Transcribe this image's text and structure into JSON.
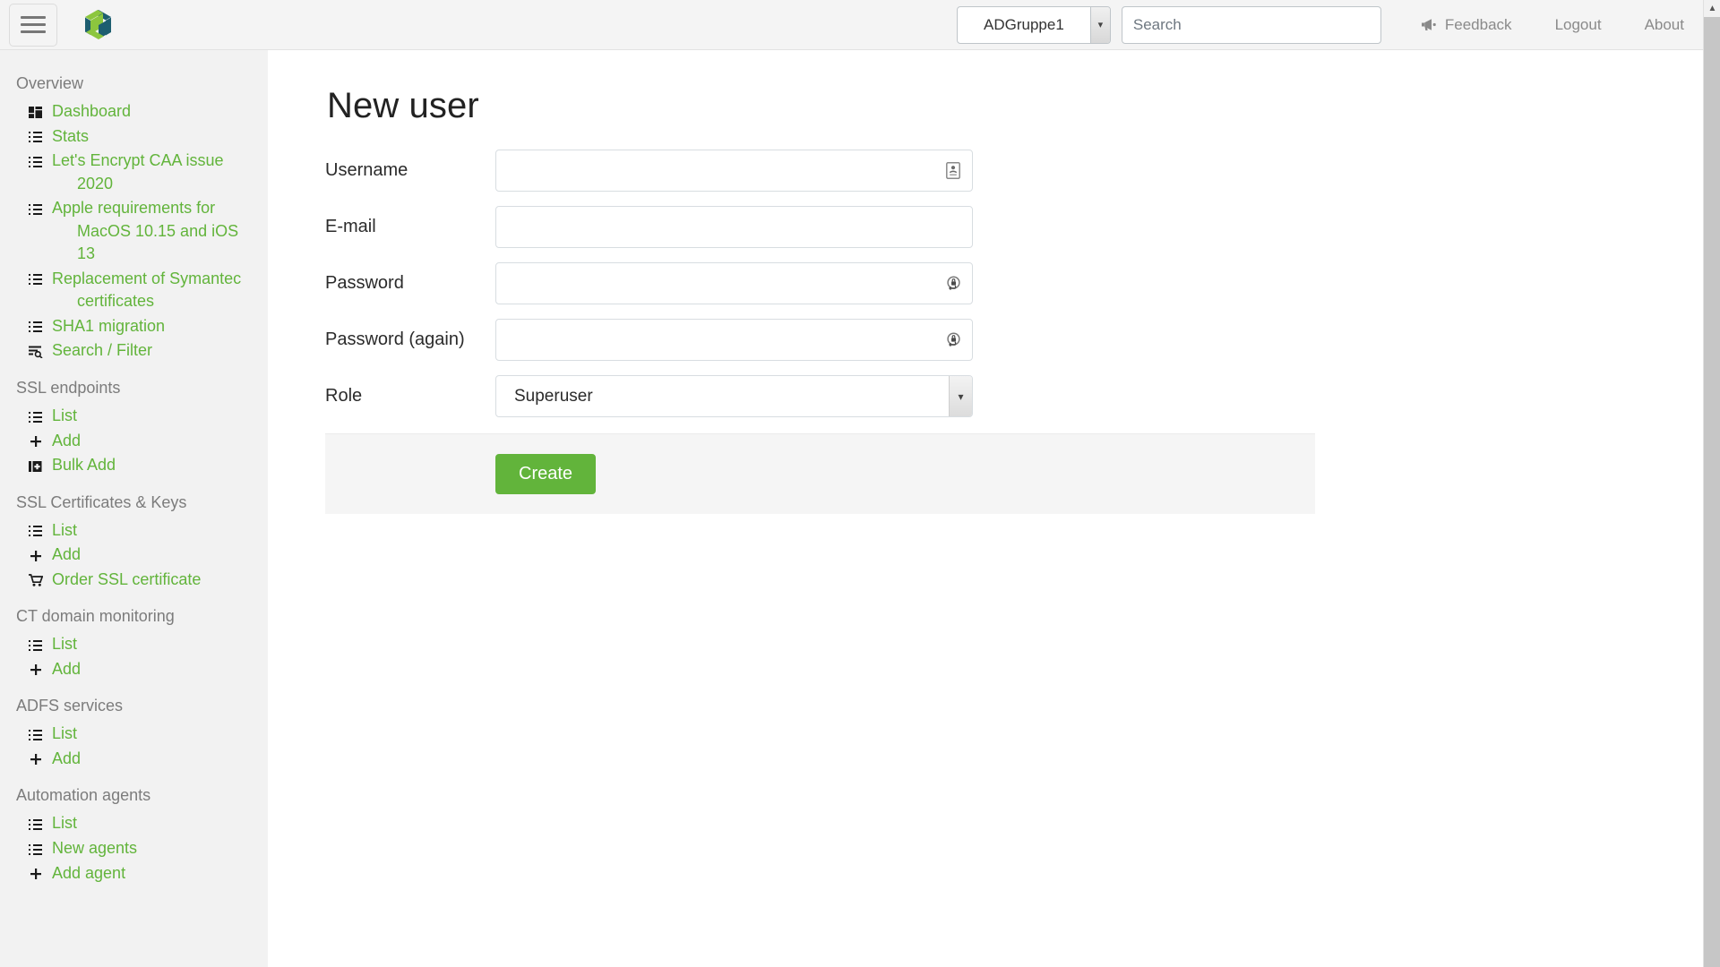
{
  "topbar": {
    "menu_icon": "hamburger-icon",
    "logo_icon": "cube-logo",
    "group_select": {
      "value": "ADGruppe1",
      "options": [
        "ADGruppe1"
      ]
    },
    "search": {
      "value": "",
      "placeholder": "Search"
    },
    "links": [
      {
        "label": "Feedback",
        "icon": "megaphone-icon"
      },
      {
        "label": "Logout",
        "icon": ""
      },
      {
        "label": "About",
        "icon": ""
      }
    ]
  },
  "sidebar": {
    "groups": [
      {
        "heading": "Overview",
        "items": [
          {
            "label": "Dashboard",
            "icon": "dashboard-icon"
          },
          {
            "label": "Stats",
            "icon": "list-icon"
          },
          {
            "label": "Let's Encrypt CAA issue 2020",
            "icon": "list-icon"
          },
          {
            "label": "Apple requirements for MacOS 10.15 and iOS 13",
            "icon": "list-icon"
          },
          {
            "label": "Replacement of Symantec certificates",
            "icon": "list-icon"
          },
          {
            "label": "SHA1 migration",
            "icon": "list-icon"
          },
          {
            "label": "Search / Filter",
            "icon": "search-filter-icon"
          }
        ]
      },
      {
        "heading": "SSL endpoints",
        "items": [
          {
            "label": "List",
            "icon": "list-icon"
          },
          {
            "label": "Add",
            "icon": "plus-icon"
          },
          {
            "label": "Bulk Add",
            "icon": "bulk-add-icon"
          }
        ]
      },
      {
        "heading": "SSL Certificates & Keys",
        "items": [
          {
            "label": "List",
            "icon": "list-icon"
          },
          {
            "label": "Add",
            "icon": "plus-icon"
          },
          {
            "label": "Order SSL certificate",
            "icon": "cart-icon"
          }
        ]
      },
      {
        "heading": "CT domain monitoring",
        "items": [
          {
            "label": "List",
            "icon": "list-icon"
          },
          {
            "label": "Add",
            "icon": "plus-icon"
          }
        ]
      },
      {
        "heading": "ADFS services",
        "items": [
          {
            "label": "List",
            "icon": "list-icon"
          },
          {
            "label": "Add",
            "icon": "plus-icon"
          }
        ]
      },
      {
        "heading": "Automation agents",
        "items": [
          {
            "label": "List",
            "icon": "list-icon"
          },
          {
            "label": "New agents",
            "icon": "list-icon"
          },
          {
            "label": "Add agent",
            "icon": "plus-icon"
          }
        ]
      }
    ]
  },
  "main": {
    "title": "New user",
    "fields": [
      {
        "label": "Username",
        "value": "",
        "placeholder": "",
        "type": "text",
        "badge": "identity-card-icon"
      },
      {
        "label": "E-mail",
        "value": "",
        "placeholder": "",
        "type": "text",
        "badge": ""
      },
      {
        "label": "Password",
        "value": "",
        "placeholder": "",
        "type": "password",
        "badge": "password-key-icon"
      },
      {
        "label": "Password (again)",
        "value": "",
        "placeholder": "",
        "type": "password",
        "badge": "password-key-icon"
      }
    ],
    "role": {
      "label": "Role",
      "value": "Superuser",
      "options": [
        "Superuser"
      ]
    },
    "submit_label": "Create"
  },
  "colors": {
    "accent_green": "#62b43b",
    "link_green": "#62b43b",
    "sidebar_bg": "#f2f2f2",
    "topbar_bg": "#f4f4f4",
    "heading_gray": "#7c7c7c"
  }
}
